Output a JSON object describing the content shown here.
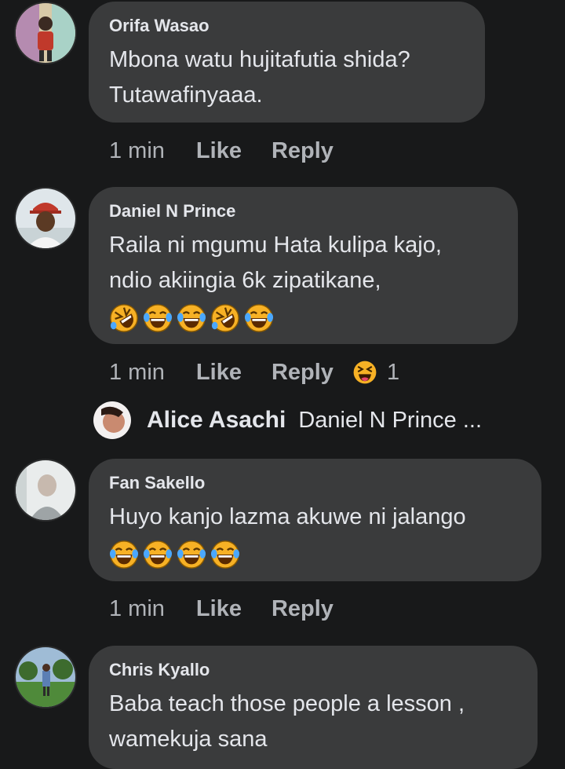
{
  "comments": [
    {
      "author": "Orifa Wasao",
      "lines": [
        "Mbona watu hujitafutia shida?",
        "Tutawafinyaaa."
      ],
      "time": "1 min",
      "like": "Like",
      "reply": "Reply"
    },
    {
      "author": "Daniel N Prince",
      "lines": [
        "Raila ni mgumu Hata kulipa kajo,",
        "ndio akiingia 6k zipatikane,"
      ],
      "emojis": [
        "rofl-emoji",
        "tears-of-joy-emoji",
        "tears-of-joy-emoji",
        "rofl-emoji",
        "tears-of-joy-emoji"
      ],
      "time": "1 min",
      "like": "Like",
      "reply": "Reply",
      "reaction_icon": "laughing-reaction-icon",
      "reaction_count": "1"
    },
    {
      "author": "Fan Sakello",
      "lines": [
        "Huyo kanjo lazma akuwe ni jalango"
      ],
      "emojis": [
        "tears-of-joy-emoji",
        "tears-of-joy-emoji",
        "tears-of-joy-emoji",
        "tears-of-joy-emoji"
      ],
      "time": "1 min",
      "like": "Like",
      "reply": "Reply"
    },
    {
      "author": "Chris Kyallo",
      "lines": [
        "Baba teach those people a lesson ,",
        "wamekuja sana"
      ]
    }
  ],
  "reply_preview": {
    "author": "Alice Asachi",
    "text": "Daniel N Prince ..."
  },
  "colors": {
    "background": "#18191a",
    "bubble": "#3a3b3c",
    "primary_text": "#e4e6eb",
    "secondary_text": "#b0b3b8"
  }
}
